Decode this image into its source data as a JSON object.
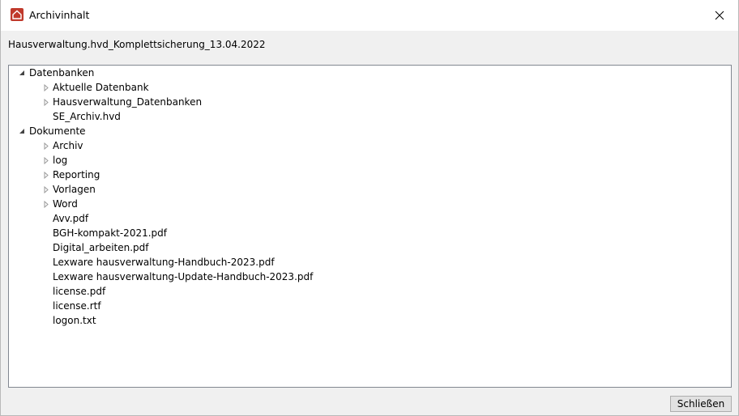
{
  "window": {
    "title": "Archivinhalt",
    "archive_name": "Hausverwaltung.hvd_Komplettsicherung_13.04.2022",
    "close_button_label": "Schließen"
  },
  "tree": {
    "datenbanken": {
      "label": "Datenbanken",
      "children": [
        "Aktuelle Datenbank",
        "Hausverwaltung_Datenbanken",
        "SE_Archiv.hvd"
      ]
    },
    "dokumente": {
      "label": "Dokumente",
      "folders": [
        "Archiv",
        "log",
        "Reporting",
        "Vorlagen",
        "Word"
      ],
      "files": [
        "Avv.pdf",
        "BGH-kompakt-2021.pdf",
        "Digital_arbeiten.pdf",
        "Lexware hausverwaltung-Handbuch-2023.pdf",
        "Lexware hausverwaltung-Update-Handbuch-2023.pdf",
        "license.pdf",
        "license.rtf",
        "logon.txt"
      ]
    }
  }
}
